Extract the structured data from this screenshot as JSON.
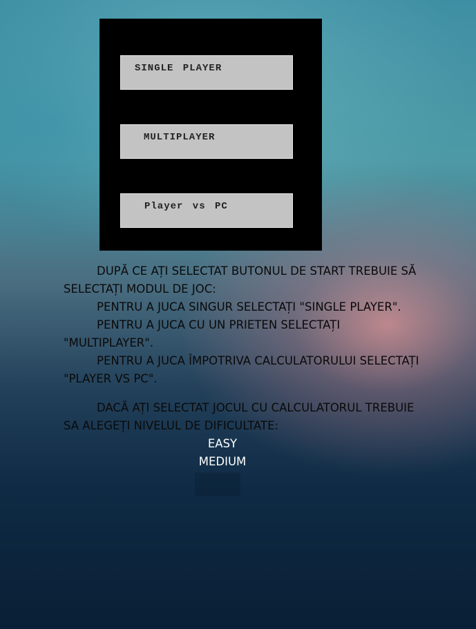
{
  "menu": {
    "buttons": [
      {
        "label": "SINGLE PLAYER"
      },
      {
        "label": "MULTIPLAYER"
      },
      {
        "label": "Player vs PC"
      }
    ]
  },
  "instructions": {
    "lines": [
      "DUPĂ CE AȚI SELECTAT BUTONUL DE START TREBUIE SĂ SELECTAȚI MODUL DE JOC:",
      "PENTRU A JUCA SINGUR SELECTAȚI \"SINGLE PLAYER\".",
      "PENTRU A JUCA CU UN PRIETEN SELECTAȚI \"MULTIPLAYER\".",
      "PENTRU A JUCA ÎMPOTRIVA CALCULATORULUI SELECTAȚI \"PLAYER VS PC\".",
      "DACĂ AȚI SELECTAT JOCUL CU CALCULATORUL TREBUIE SA ALEGEȚI NIVELUL DE DIFICULTATE:"
    ]
  },
  "difficulty": {
    "options": [
      "EASY",
      "MEDIUM"
    ]
  },
  "colors": {
    "panel": "#000000",
    "button": "#c3c3c3",
    "text_dark": "#0a0a0a",
    "text_light": "#ffffff"
  }
}
